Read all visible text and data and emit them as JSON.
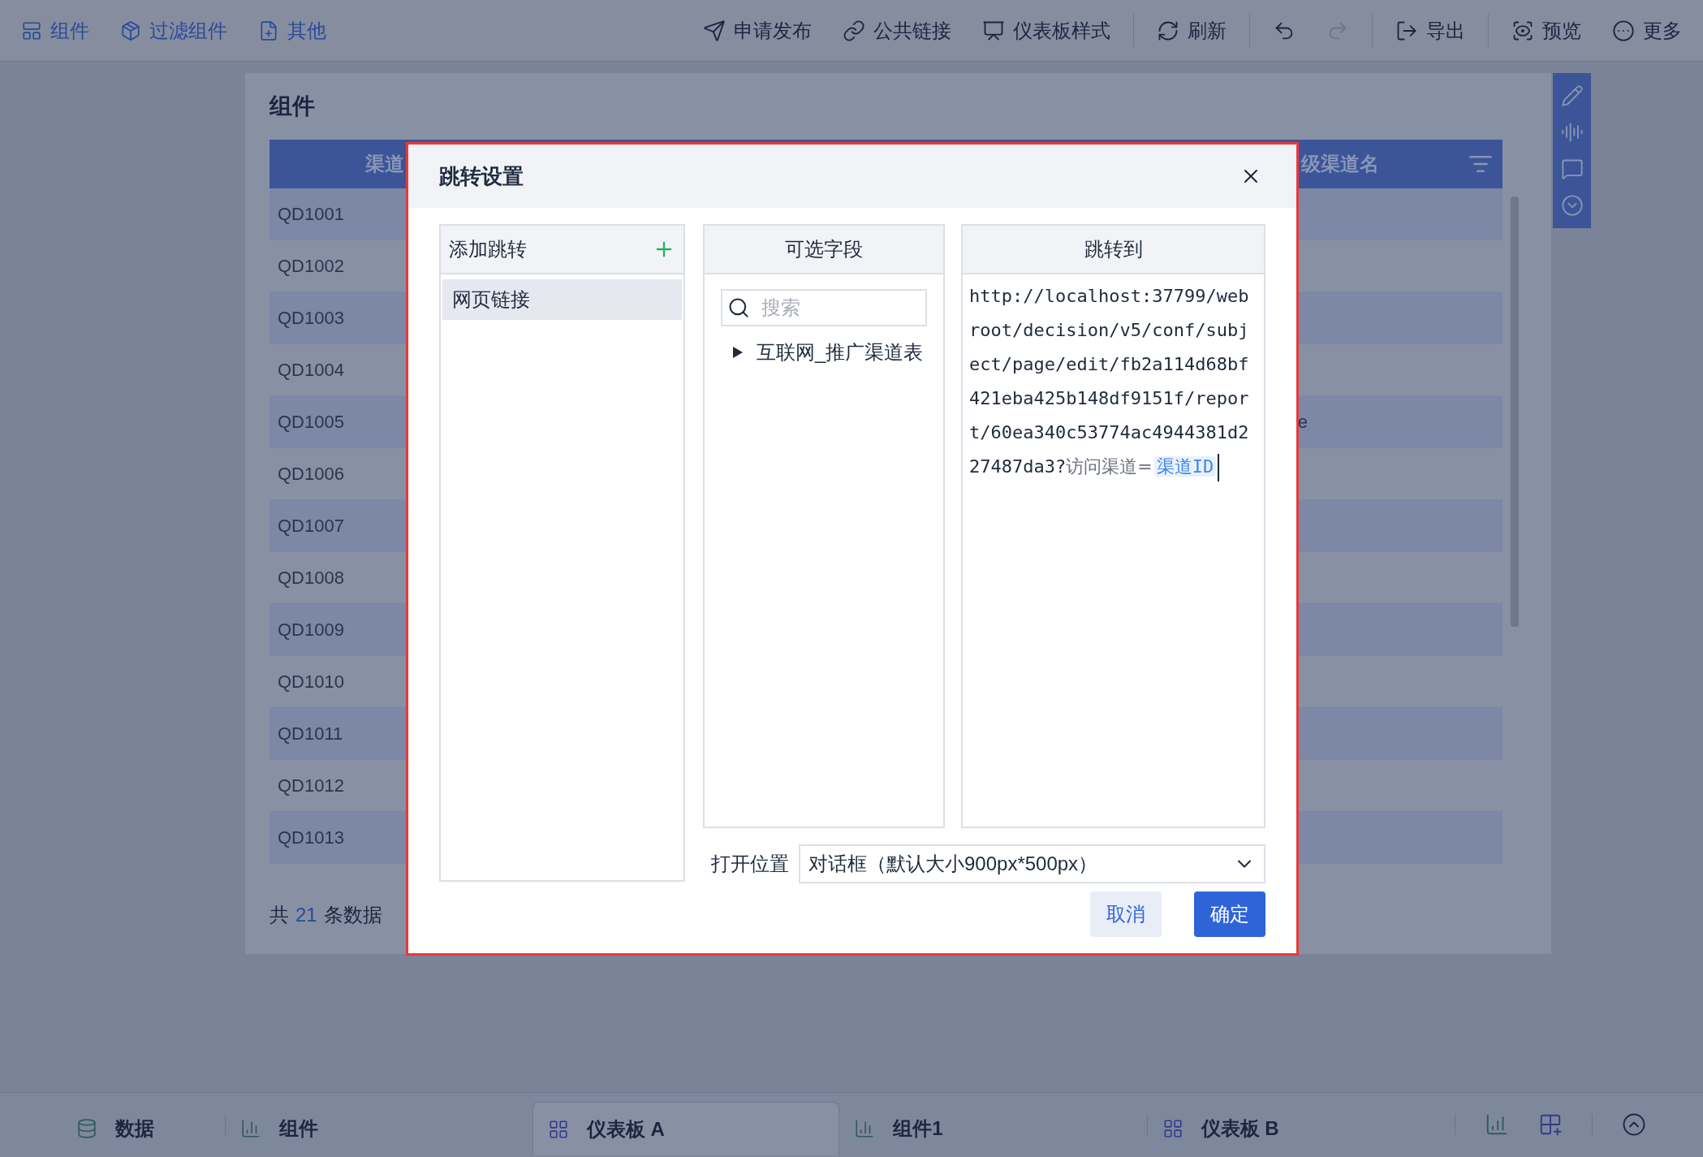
{
  "toolbar": {
    "left": [
      {
        "label": "组件"
      },
      {
        "label": "过滤组件"
      },
      {
        "label": "其他"
      }
    ],
    "right": [
      {
        "label": "申请发布"
      },
      {
        "label": "公共链接"
      },
      {
        "label": "仪表板样式"
      },
      {
        "label": "刷新"
      }
    ],
    "history": [
      {
        "disabled": false
      },
      {
        "disabled": true
      }
    ],
    "end": [
      {
        "label": "导出"
      },
      {
        "label": "预览"
      },
      {
        "label": "更多"
      }
    ]
  },
  "component": {
    "title": "组件",
    "table": {
      "columns": [
        "渠道",
        "级渠道名"
      ],
      "rows": [
        {
          "column_1": "QD1001"
        },
        {
          "column_1": "QD1002"
        },
        {
          "column_1": "QD1003"
        },
        {
          "column_1": "QD1004"
        },
        {
          "column_1": "QD1005",
          "column_last": "e"
        },
        {
          "column_1": "QD1006"
        },
        {
          "column_1": "QD1007"
        },
        {
          "column_1": "QD1008"
        },
        {
          "column_1": "QD1009"
        },
        {
          "column_1": "QD1010"
        },
        {
          "column_1": "QD1011"
        },
        {
          "column_1": "QD1012"
        },
        {
          "column_1": "QD1013"
        }
      ]
    },
    "footer": {
      "prefix": "共",
      "count": "21",
      "suffix": "条数据"
    }
  },
  "dialog": {
    "title": "跳转设置",
    "jumps": {
      "header": "添加跳转",
      "items": [
        {
          "label": "网页链接",
          "selected": true
        }
      ]
    },
    "fields": {
      "header": "可选字段",
      "search_placeholder": "搜索",
      "tree": [
        {
          "label": "互联网_推广渠道表",
          "expanded": false
        }
      ]
    },
    "target": {
      "header": "跳转到",
      "url": "http://localhost:37799/webroot/decision/v5/conf/subject/page/edit/fb2a114d68bf421eba425b148df9151f/report/60ea340c53774ac4944381d227487da3?",
      "param": "访问渠道=",
      "field": "渠道ID"
    },
    "open_position": {
      "label": "打开位置",
      "value": "对话框（默认大小900px*500px）"
    },
    "buttons": [
      {
        "label": "取消",
        "kind": "secondary"
      },
      {
        "label": "确定",
        "kind": "primary"
      }
    ]
  },
  "bottom_tabs": [
    {
      "label": "数据",
      "kind": "data",
      "selected": false
    },
    {
      "label": "组件",
      "kind": "component",
      "selected": false
    },
    {
      "label": "仪表板 A",
      "kind": "dashboard",
      "selected": true
    },
    {
      "label": "组件1",
      "kind": "component",
      "selected": false
    },
    {
      "label": "仪表板 B",
      "kind": "dashboard",
      "selected": false
    }
  ]
}
